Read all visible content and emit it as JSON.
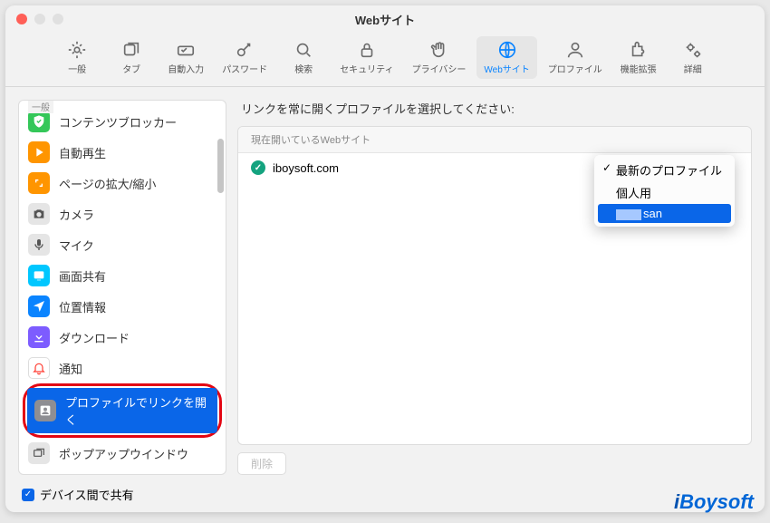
{
  "window": {
    "title": "Webサイト"
  },
  "toolbar": {
    "items": [
      {
        "id": "general",
        "label": "一般"
      },
      {
        "id": "tabs",
        "label": "タブ"
      },
      {
        "id": "autofill",
        "label": "自動入力"
      },
      {
        "id": "passwords",
        "label": "パスワード"
      },
      {
        "id": "search",
        "label": "検索"
      },
      {
        "id": "security",
        "label": "セキュリティ"
      },
      {
        "id": "privacy",
        "label": "プライバシー"
      },
      {
        "id": "websites",
        "label": "Webサイト"
      },
      {
        "id": "profiles",
        "label": "プロファイル"
      },
      {
        "id": "extensions",
        "label": "機能拡張"
      },
      {
        "id": "advanced",
        "label": "詳細"
      }
    ]
  },
  "sidebar": {
    "section": "一般",
    "items": [
      {
        "label": "コンテンツブロッカー"
      },
      {
        "label": "自動再生"
      },
      {
        "label": "ページの拡大/縮小"
      },
      {
        "label": "カメラ"
      },
      {
        "label": "マイク"
      },
      {
        "label": "画面共有"
      },
      {
        "label": "位置情報"
      },
      {
        "label": "ダウンロード"
      },
      {
        "label": "通知"
      },
      {
        "label": "プロファイルでリンクを開く"
      },
      {
        "label": "ポップアップウインドウ"
      }
    ]
  },
  "main": {
    "instruction": "リンクを常に開くプロファイルを選択してください:",
    "column_header": "現在開いているWebサイト",
    "rows": [
      {
        "site": "iboysoft.com"
      }
    ],
    "dropdown": {
      "options": [
        {
          "label": "最新のプロファイル",
          "checked": true
        },
        {
          "label": "個人用"
        },
        {
          "label": "san",
          "highlighted": true,
          "redacted_prefix": true
        }
      ]
    },
    "delete_button": "削除"
  },
  "footer": {
    "share_label": "デバイス間で共有"
  },
  "branding": {
    "logo": "iBoysoft"
  }
}
